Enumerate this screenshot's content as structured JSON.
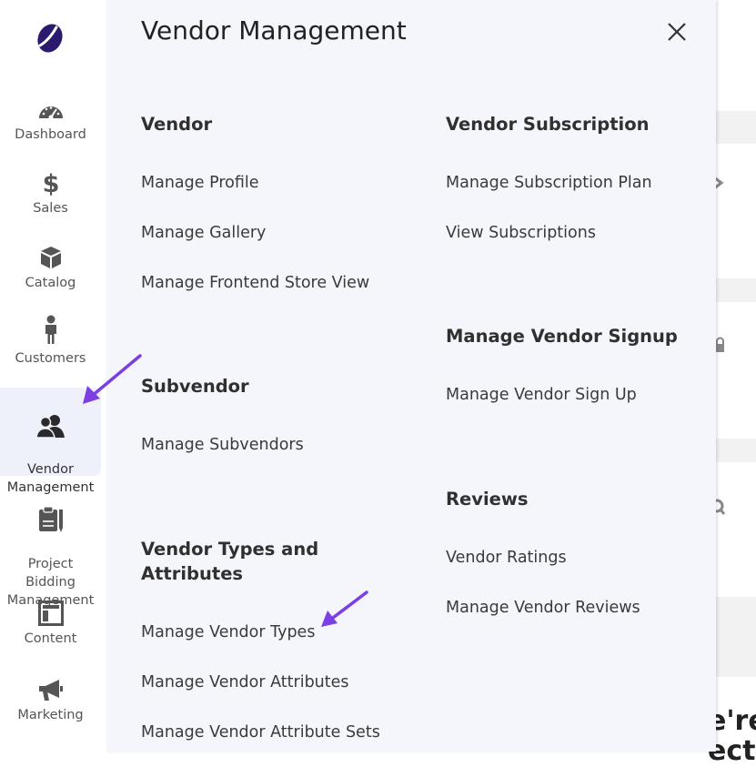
{
  "sidebar": {
    "items": [
      {
        "label": "Dashboard",
        "icon": "speedometer-icon"
      },
      {
        "label": "Sales",
        "icon": "dollar-icon"
      },
      {
        "label": "Catalog",
        "icon": "box-icon"
      },
      {
        "label": "Customers",
        "icon": "person-icon"
      },
      {
        "label": "Vendor\nManagement",
        "icon": "users-icon",
        "active": true
      },
      {
        "label": "Project\nBidding\nManagement",
        "icon": "clipboard-icon"
      },
      {
        "label": "Content",
        "icon": "layout-icon"
      },
      {
        "label": "Marketing",
        "icon": "megaphone-icon"
      }
    ]
  },
  "panel": {
    "title": "Vendor Management",
    "sections": {
      "vendor": {
        "title": "Vendor",
        "links": [
          "Manage Profile",
          "Manage Gallery",
          "Manage Frontend Store View"
        ]
      },
      "subvendor": {
        "title": "Subvendor",
        "links": [
          "Manage Subvendors"
        ]
      },
      "types": {
        "title": "Vendor Types and\nAttributes",
        "links": [
          "Manage Vendor Types",
          "Manage Vendor Attributes",
          "Manage Vendor Attribute Sets"
        ]
      },
      "subscription": {
        "title": "Vendor Subscription",
        "links": [
          "Manage Subscription Plan",
          "View Subscriptions"
        ]
      },
      "signup": {
        "title": "Manage Vendor Signup",
        "links": [
          "Manage Vendor Sign Up"
        ]
      },
      "reviews": {
        "title": "Reviews",
        "links": [
          "Vendor Ratings",
          "Manage Vendor Reviews"
        ]
      }
    }
  },
  "background": {
    "partial_text_1": "e're",
    "partial_text_2": "ectu"
  },
  "colors": {
    "accent": "#7b3fe4",
    "panel_bg": "#f4f6fb",
    "active_bg": "#eef1fa",
    "logo": "#2b1a6e"
  }
}
